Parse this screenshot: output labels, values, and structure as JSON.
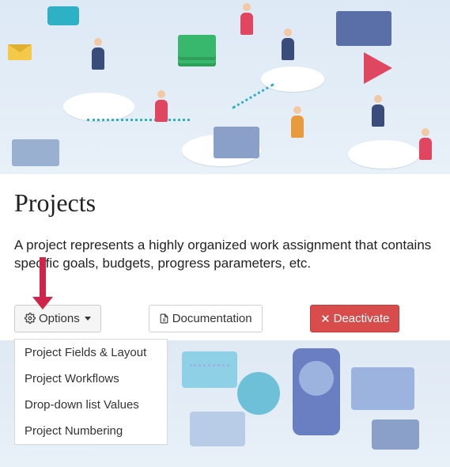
{
  "page": {
    "title": "Projects",
    "description": "A project represents a highly organized work assignment that contains specific goals, budgets, progress parameters, etc."
  },
  "toolbar": {
    "options_label": "Options",
    "documentation_label": "Documentation",
    "deactivate_label": "Deactivate"
  },
  "options_menu": {
    "items": [
      {
        "label": "Project Fields & Layout"
      },
      {
        "label": "Project Workflows"
      },
      {
        "label": "Drop-down list Values"
      },
      {
        "label": "Project Numbering"
      }
    ]
  }
}
